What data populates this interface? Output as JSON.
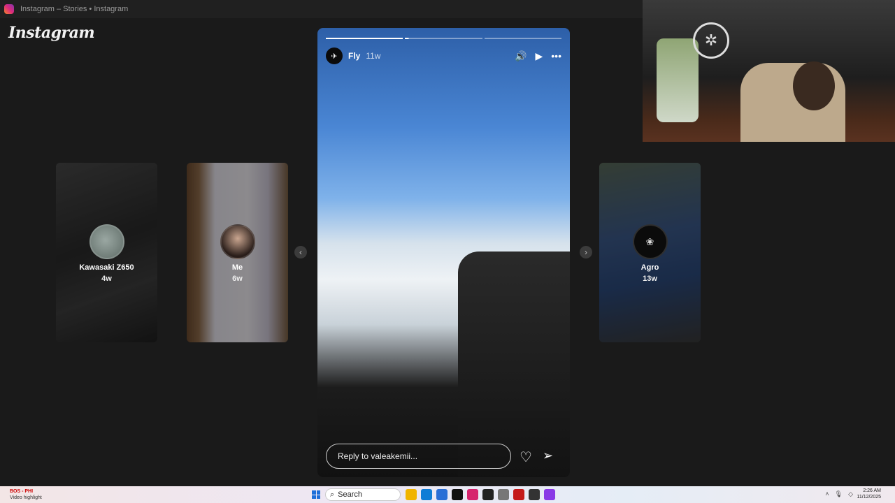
{
  "window": {
    "title": "Instagram – Stories • Instagram"
  },
  "brand": {
    "logo_text": "Instagram"
  },
  "side_stories": [
    {
      "name": "Kawasaki Z650",
      "age": "4w"
    },
    {
      "name": "Me",
      "age": "6w"
    },
    {
      "name": "Agro",
      "age": "13w"
    }
  ],
  "nav": {
    "prev_icon": "chevron-left-icon",
    "next_icon": "chevron-right-icon"
  },
  "story": {
    "progress": {
      "segments": 3,
      "completed": 1,
      "current_fraction": 0.05
    },
    "username": "Fly",
    "time": "11w",
    "controls": [
      "volume-icon",
      "play-icon",
      "more-icon"
    ]
  },
  "reply": {
    "placeholder": "Reply to valeakemii..."
  },
  "taskbar": {
    "weather_line1": "BOS - PHI",
    "weather_line2": "Video highlight",
    "search_label": "Search",
    "time": "2:26 AM",
    "date": "11/12/2025",
    "apps": [
      {
        "icon": "file-explorer-icon",
        "color": "#f0b400"
      },
      {
        "icon": "edge-icon",
        "color": "#0f7dd6"
      },
      {
        "icon": "store-icon",
        "color": "#2a6fd6"
      },
      {
        "icon": "tiktok-icon",
        "color": "#111111"
      },
      {
        "icon": "instagram-icon",
        "color": "#d6246e"
      },
      {
        "icon": "app-icon",
        "color": "#222222"
      },
      {
        "icon": "settings-icon",
        "color": "#777777"
      },
      {
        "icon": "obs-icon",
        "color": "#c41a1a"
      },
      {
        "icon": "app-icon-2",
        "color": "#333333"
      },
      {
        "icon": "messenger-icon",
        "color": "#8a3ae6"
      }
    ]
  }
}
